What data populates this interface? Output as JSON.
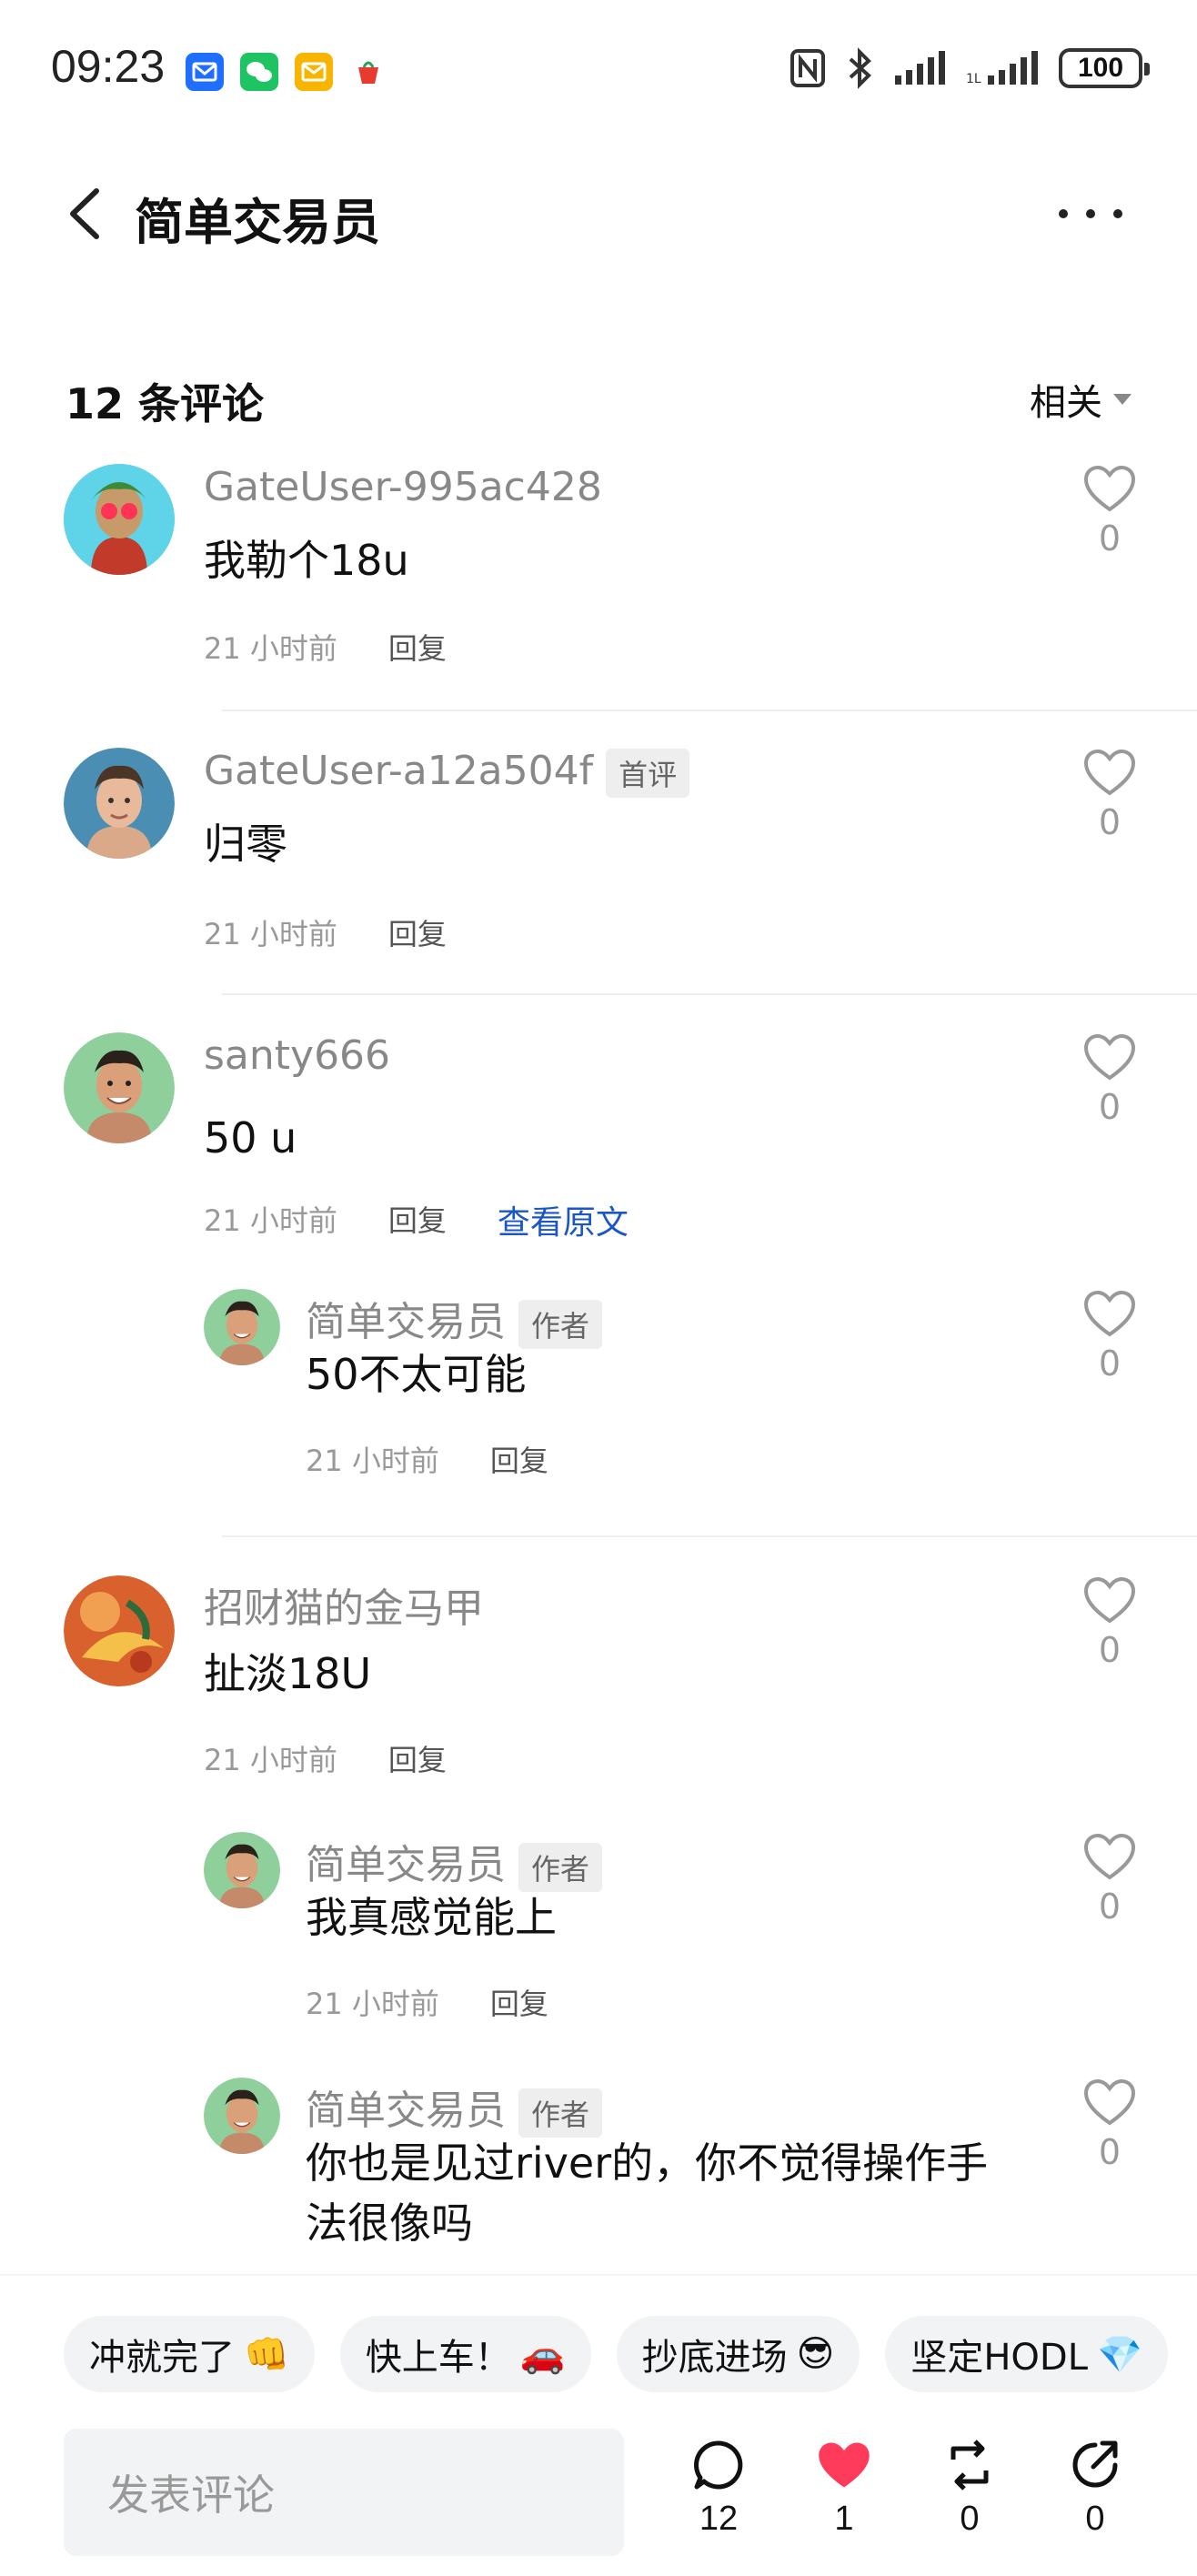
{
  "status_bar": {
    "time": "09:23",
    "battery": "100",
    "icons": [
      "mail-icon",
      "wechat-icon",
      "message-icon",
      "app-icon",
      "nfc-icon",
      "bluetooth-icon",
      "signal-icon",
      "signal-4g-icon",
      "battery-icon"
    ]
  },
  "header": {
    "title": "简单交易员",
    "back_icon": "back-chevron-icon",
    "more_icon": "more-dots-icon"
  },
  "comments_header": {
    "count_label": "12 条评论",
    "sort_label": "相关"
  },
  "comments": [
    {
      "user": "GateUser-995ac428",
      "text": "我勒个18u",
      "time": "21 小时前",
      "reply": "回复",
      "likes": "0"
    },
    {
      "user": "GateUser-a12a504f",
      "badge": "首评",
      "text": "归零",
      "time": "21 小时前",
      "reply": "回复",
      "likes": "0"
    },
    {
      "user": "santy666",
      "text": "50 u",
      "time": "21 小时前",
      "reply": "回复",
      "view_original": "查看原文",
      "likes": "0",
      "replies": [
        {
          "user": "简单交易员",
          "badge": "作者",
          "text": "50不太可能",
          "time": "21 小时前",
          "reply": "回复",
          "likes": "0"
        }
      ]
    },
    {
      "user": "招财猫的金马甲",
      "text": "扯淡18U",
      "time": "21 小时前",
      "reply": "回复",
      "likes": "0",
      "replies": [
        {
          "user": "简单交易员",
          "badge": "作者",
          "text": "我真感觉能上",
          "time": "21 小时前",
          "reply": "回复",
          "likes": "0"
        },
        {
          "user": "简单交易员",
          "badge": "作者",
          "text_line1": "你也是见过river的，你不觉得操作手",
          "text_line2": "法很像吗",
          "likes": "0"
        }
      ]
    }
  ],
  "quick_replies": [
    {
      "label": "冲就完了",
      "emoji": "👊"
    },
    {
      "label": "快上车！",
      "emoji": "🚗"
    },
    {
      "label": "抄底进场",
      "emoji": "😎"
    },
    {
      "label": "坚定HODL",
      "emoji": "💎"
    }
  ],
  "composer": {
    "placeholder": "发表评论"
  },
  "actions": {
    "comments": "12",
    "likes": "1",
    "reposts": "0",
    "shares": "0"
  },
  "colors": {
    "accent_link": "#1a56c8",
    "like_active": "#ff3b5c",
    "muted": "#999999"
  }
}
